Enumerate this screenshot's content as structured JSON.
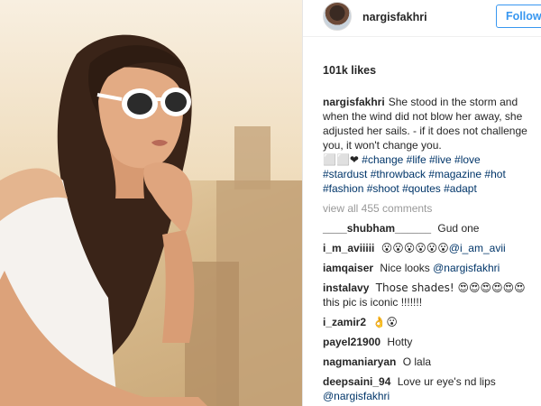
{
  "post": {
    "username": "nargisfakhri",
    "follow_label": "Follow",
    "likes": "101k likes",
    "caption": {
      "username": "nargisfakhri",
      "text": "She stood in the storm and when the wind did not blow her away, she adjusted her sails. - if it does not challenge you, it won't change you.",
      "emoji": "⬜⬜❤",
      "hashtags_line1": "#change #life #live #love",
      "hashtags_line2": "#stardust #throwback #magazine #hot",
      "hashtags_line3": "#fashion #shoot #qoutes #adapt"
    },
    "view_all": "view all 455 comments"
  },
  "comments": [
    {
      "user": "____shubham______",
      "text": "Gud one",
      "mention": ""
    },
    {
      "user": "i_m_aviiiii",
      "text": "😮😮😮😮😮😮",
      "mention": "@i_am_avii"
    },
    {
      "user": "iamqaiser",
      "text": "Nice looks",
      "mention": "@nargisfakhri"
    },
    {
      "user": "instalavy",
      "text": "Those shades! 😍😍😍😍😍😍",
      "text2": "this pic is iconic !!!!!!!",
      "mention": ""
    },
    {
      "user": "i_zamir2",
      "text": "👌😮",
      "mention": ""
    },
    {
      "user": "payel21900",
      "text": "Hotty",
      "mention": ""
    },
    {
      "user": "nagmaniaryan",
      "text": "O lala",
      "mention": ""
    },
    {
      "user": "deepsaini_94",
      "text": "Love ur eye's nd lips",
      "mention": "@nargisfakhri"
    }
  ],
  "colors": {
    "follow_blue": "#3897f0",
    "link_blue": "#003569",
    "text": "#262626",
    "muted": "#999999"
  },
  "icons": {
    "avatar": "profile-avatar"
  }
}
